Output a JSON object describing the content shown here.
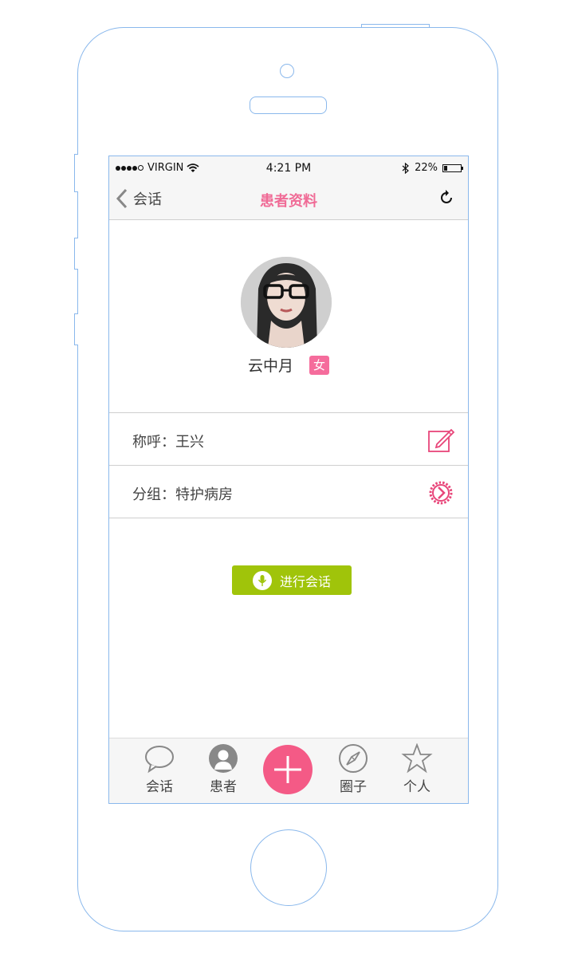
{
  "status_bar": {
    "carrier": "VIRGIN",
    "time": "4:21 PM",
    "battery": "22%",
    "battery_level": 0.22
  },
  "nav": {
    "back_label": "会话",
    "title": "患者资料"
  },
  "profile": {
    "name": "云中月",
    "gender": "女"
  },
  "rows": {
    "nickname": "称呼：王兴",
    "group": "分组：特护病房"
  },
  "chat_button": {
    "label": "进行会话"
  },
  "tab_bar": {
    "conversations": "会话",
    "patients": "患者",
    "circle": "圈子",
    "profile": "个人"
  },
  "colors": {
    "accent_pink": "#f06b96",
    "chat_green": "#a0c40a",
    "outline_blue": "#8ab8ec"
  }
}
